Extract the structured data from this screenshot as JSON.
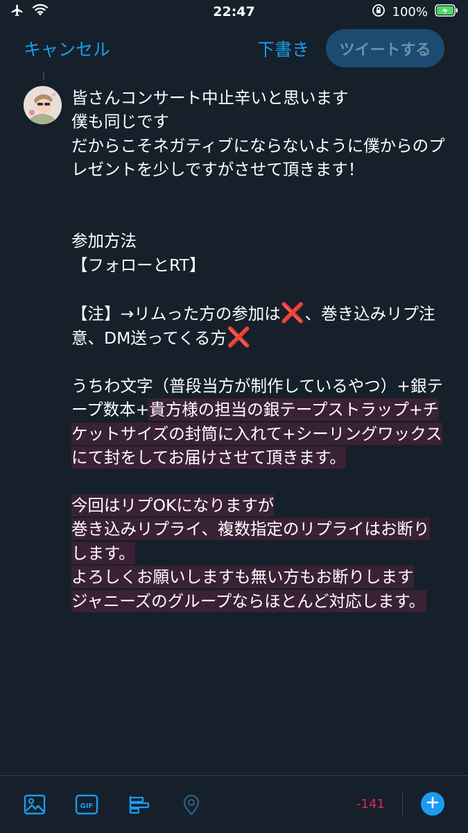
{
  "status_bar": {
    "time": "22:47",
    "battery_percent": "100%",
    "icons": [
      "airplane-icon",
      "wifi-icon",
      "orientation-lock-icon",
      "battery-charging-icon"
    ]
  },
  "header": {
    "cancel_label": "キャンセル",
    "draft_label": "下書き",
    "tweet_label": "ツイートする"
  },
  "compose": {
    "avatar_icon": "avatar",
    "text_main": "皆さんコンサート中止辛いと思います\n僕も同じです\nだからこそネガティブにならないように僕からのプレゼントを少しですがさせて頂きます！\n\n\n参加方法\n【フォローとRT】\n\n【注】→リムった方の参加は",
    "x_mark_1": "❌",
    "text_after_x1": "、巻き込みリプ注意、DM送ってくる方",
    "x_mark_2": "❌",
    "text_before_overflow": "\n\nうちわ文字（普段当方が制作しているやつ）+銀テープ数本+",
    "text_overflow": "貴方様の担当の銀テープストラップ+チケットサイズの封筒に入れて+シーリングワックスにて封をしてお届けさせて頂きます。\n\n今回はリプOKになりますが\n巻き込みリプライ、複数指定のリプライはお断りします。\nよろしくお願いしますも無い方もお断りします\nジャニーズのグループならほとんど対応します。"
  },
  "toolbar": {
    "icons": [
      "image-icon",
      "gif-icon",
      "poll-icon",
      "location-icon"
    ],
    "char_counter": "-141",
    "add_icon": "plus-icon"
  },
  "colors": {
    "background": "#15202b",
    "accent": "#1d9bf0",
    "overflow_highlight": "#3b2136",
    "counter_negative": "#e0245e"
  }
}
